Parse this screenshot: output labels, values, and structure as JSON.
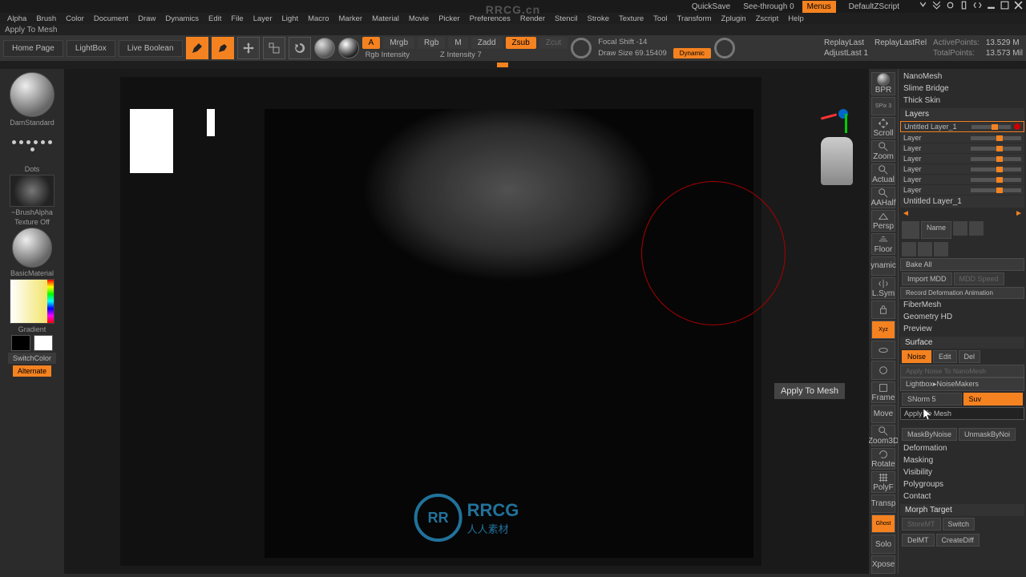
{
  "topbar": {
    "quicksave": "QuickSave",
    "see_through": "See-through",
    "see_through_val": "0",
    "menus": "Menus",
    "default_zscript": "DefaultZScript"
  },
  "menubar": [
    "Alpha",
    "Brush",
    "Color",
    "Document",
    "Draw",
    "Dynamics",
    "Edit",
    "File",
    "Layer",
    "Light",
    "Macro",
    "Marker",
    "Material",
    "Movie",
    "Picker",
    "Preferences",
    "Render",
    "Stencil",
    "Stroke",
    "Texture",
    "Tool",
    "Transform",
    "Zplugin",
    "Zscript",
    "Help"
  ],
  "status": "Apply To Mesh",
  "cmd": {
    "home": "Home Page",
    "lightbox": "LightBox",
    "live_bool": "Live Boolean",
    "edit": "Edit",
    "draw": "Draw",
    "move": "Move",
    "scale": "Scale",
    "rotate": "Rotate",
    "a_label": "A",
    "mrgb": "Mrgb",
    "rgb": "Rgb",
    "m": "M",
    "zadd": "Zadd",
    "zsub": "Zsub",
    "zcut": "Zcut",
    "rgb_int": "Rgb Intensity",
    "focal": "Focal Shift -14",
    "drawsize": "Draw Size 69.15409",
    "dynamic": "Dynamic",
    "zint": "Z Intensity 7",
    "replay": "ReplayLast",
    "replay_rel": "ReplayLastRel",
    "adjust": "AdjustLast",
    "adjust_val": "1",
    "active_pts": "ActivePoints:",
    "active_val": "13.529 M",
    "total_pts": "TotalPoints:",
    "total_val": "13.573 Mil"
  },
  "left": {
    "brush": "DamStandard",
    "stroke": "Dots",
    "alpha": "~BrushAlpha",
    "texture": "Texture Off",
    "material": "BasicMaterial",
    "gradient": "Gradient",
    "switch": "SwitchColor",
    "alternate": "Alternate"
  },
  "right_tools": {
    "bpr": "BPR",
    "spix": "SPix 3",
    "scroll": "Scroll",
    "zoom": "Zoom",
    "actual": "Actual",
    "aahalf": "AAHalf",
    "persp": "Persp",
    "floor": "Floor",
    "dynamic": "ynamic",
    "lsym": "L.Sym",
    "lock": "",
    "xyz": "Xyz",
    "frame": "Frame",
    "move": "Move",
    "zoom3d": "Zoom3D",
    "rotate": "Rotate",
    "polyf": "PolyF",
    "transp": "Transp",
    "ghost": "Ghost",
    "solo": "Solo",
    "xpose": "Xpose"
  },
  "panel": {
    "nanomesh": "NanoMesh",
    "slime": "Slime Bridge",
    "thick": "Thick Skin",
    "layers": "Layers",
    "layers_list": [
      "Untitled Layer_1",
      "Layer",
      "Layer",
      "Layer",
      "Layer",
      "Layer",
      "Layer"
    ],
    "untitled2": "Untitled Layer_1",
    "name": "Name",
    "bakeall": "Bake All",
    "import_mdd": "Import MDD",
    "mdd_speed": "MDD Speed",
    "record_def": "Record Deformation Animation",
    "fibermesh": "FiberMesh",
    "geohd": "Geometry HD",
    "preview": "Preview",
    "surface": "Surface",
    "noise": "Noise",
    "edit": "Edit",
    "del": "Del",
    "apply_noise_nano": "Apply Noise To NanoMesh",
    "lightbox_noise": "Lightbox▸NoiseMakers",
    "snorm": "SNorm 5",
    "suv": "Suv",
    "apply_mesh": "Apply To Mesh",
    "maskbynoise": "MaskByNoise",
    "unmaskbynoise": "UnmaskByNoi",
    "deformation": "Deformation",
    "masking": "Masking",
    "visibility": "Visibility",
    "polygroups": "Polygroups",
    "contact": "Contact",
    "morph": "Morph Target",
    "storemt": "StoreMT",
    "switch": "Switch",
    "delmt": "DelMT",
    "creatediff": "CreateDiff"
  },
  "tooltip": "Apply To Mesh",
  "watermark1": "RRCG.cn",
  "watermark2_txt": "RRCG",
  "watermark2_sub": "人人素材"
}
